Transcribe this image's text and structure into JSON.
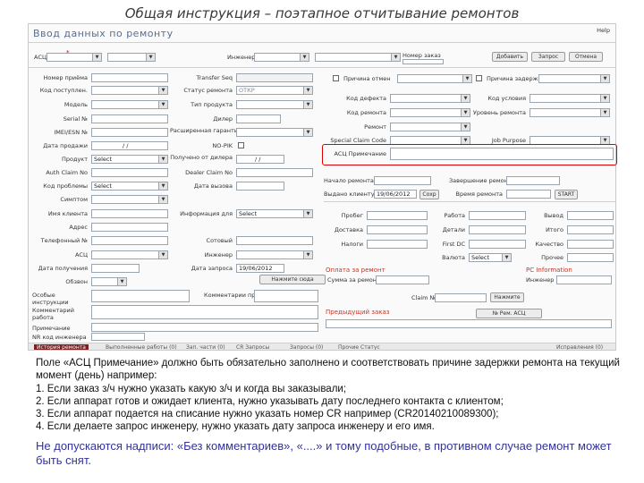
{
  "slide_title": "Общая инструкция – поэтапное отчитывание ремонтов",
  "form": {
    "title": "Ввод данных по ремонту",
    "help": "Help",
    "top": {
      "asc_label": "АСЦ",
      "engineer_label": "Инженер",
      "order_label": "Номер заказ",
      "add_button": "Добавить",
      "request_button": "Запрос",
      "cancel_button": "Отмена"
    },
    "left_labels": [
      "Номер приёма",
      "Код поступлен.",
      "Модель",
      "Serial №",
      "IMEI/ESN №",
      "Дата продажи",
      "Продукт",
      "Auth Claim No",
      "Код проблемы",
      "Симптом",
      "Имя клиента",
      "Адрес",
      "Телефонный №",
      "АСЦ",
      "Дата получения",
      "Обзвон"
    ],
    "mid_labels": [
      "Transfer Seq",
      "Статус ремонта",
      "Тип продукта",
      "Дилер",
      "Расширенная гарантия",
      "NO-PIK",
      "Получено от дилера",
      "Dealer Claim No",
      "Дата вызова",
      "Информация для",
      "Сотовый",
      "Инженер",
      "Дата запроса"
    ],
    "right_labels": [
      "Причина отмен",
      "Код дефекта",
      "Код ремонта",
      "Ремонт",
      "Special Claim Code",
      "АСЦ Примечание",
      "Причина задерж",
      "Код условия",
      "Уровень ремонта",
      "Job Purpose"
    ],
    "status_value": "ОТКР",
    "selects": {
      "product": "Select",
      "problem": "Select",
      "client_info": "Select",
      "currency": "Select"
    },
    "dates": {
      "sale": "/ /",
      "dealer": "/ /",
      "request": "19/06/2012",
      "issue": "19/06/2012"
    },
    "lower_right_labels": [
      "Начало ремонта",
      "Выдано клиенту",
      "Завершение ремонта",
      "Время ремонта",
      "Пробег",
      "Доставка",
      "Налоги",
      "Работа",
      "Детали",
      "First DC",
      "Валюта",
      "Вывод",
      "Итого",
      "Качество",
      "Прочее"
    ],
    "misc_buttons": [
      "Сохр",
      "START",
      "Нажмите сюда"
    ],
    "sections": {
      "repair_payment": "Оплата за ремонт",
      "pc_info": "PC Information",
      "prev_order": "Предыдущий заказ"
    },
    "payment": {
      "sum_label": "Сумма за ремонт",
      "claim_label": "Claim №",
      "claim_button": "Нажмите",
      "engineer_label": "Инженер"
    },
    "notes": {
      "special_label": "Особые инструкции",
      "client_comment_label": "Комментарии при получения",
      "work_comment_label": "Комментарий работа",
      "remarks_label": "Примечание",
      "cr_label": "NR код инженера",
      "no_button": "№ Рем. АСЦ"
    },
    "tabs": [
      "История ремонта",
      "Выполненные работы (0)",
      "Зап. части (0)",
      "CR Запросы",
      "Запросы (0)",
      "Прочие Статус",
      "Исправления (0)"
    ]
  },
  "body_text": {
    "para_intro": "Поле «АСЦ Примечание» должно быть обязательно заполнено и соответствовать причине задержки ремонта на текущий момент (день) например:",
    "items": [
      "1.  Если заказ з/ч нужно указать какую з/ч и когда вы заказывали;",
      "2.  Если аппарат готов и ожидает клиента, нужно указывать дату последнего контакта с клиентом;",
      "3.  Если аппарат подается на списание нужно указать номер CR например (CR20140210089300);",
      "4.  Если делаете запрос инженеру, нужно указать дату запроса инженеру и его имя."
    ],
    "warning": "Не допускаются надписи: «Без комментариев», «....» и тому подобные, в противном случае ремонт может быть снят."
  }
}
